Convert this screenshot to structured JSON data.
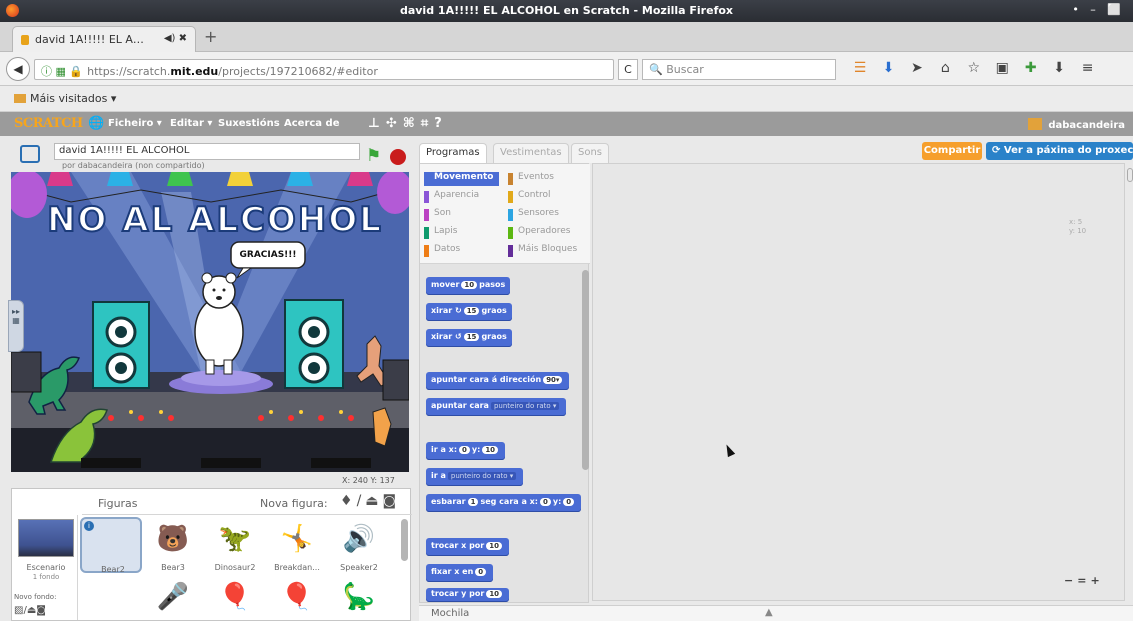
{
  "window": {
    "title": "david 1A!!!!! EL ALCOHOL en Scratch - Mozilla Firefox",
    "controls": "• – ⬜"
  },
  "browser": {
    "tab": {
      "label": "david 1A!!!!! EL A…",
      "controls": "◀) ✖"
    },
    "newtab": "+",
    "url_prefix": "https://scratch.",
    "url_domain": "mit.edu",
    "url_path": "/projects/197210682/#editor",
    "reload": "C",
    "search_placeholder": "Buscar",
    "bookmarks_label": "Máis visitados"
  },
  "scratch": {
    "logo": "SCRATCH",
    "menu": [
      "Ficheiro ▾",
      "Editar ▾",
      "Suxestións",
      "Acerca de"
    ],
    "user": "dabacandeira",
    "project_title": "david 1A!!!!! EL ALCOHOL",
    "project_owner": "por dabacandeira (non compartido)",
    "stage_coords": "X: 240  Y: 137",
    "stage": {
      "banner": "NO AL ALCOHOL",
      "speech": "GRACIAS!!!"
    },
    "tabs": {
      "scripts": "Programas",
      "costumes": "Vestimentas",
      "sounds": "Sons"
    },
    "share": "Compartir",
    "see_project": "Ver a páxina do proxecto",
    "categories": [
      {
        "label": "Movemento",
        "color": "#4a6cd4",
        "active": true
      },
      {
        "label": "Eventos",
        "color": "#c88330"
      },
      {
        "label": "Aparencia",
        "color": "#8a55d7"
      },
      {
        "label": "Control",
        "color": "#e1a91a"
      },
      {
        "label": "Son",
        "color": "#bb42c3"
      },
      {
        "label": "Sensores",
        "color": "#2ca5e2"
      },
      {
        "label": "Lapis",
        "color": "#0e9a6c"
      },
      {
        "label": "Operadores",
        "color": "#5cb712"
      },
      {
        "label": "Datos",
        "color": "#ee7d16"
      },
      {
        "label": "Máis Bloques",
        "color": "#632d99"
      }
    ],
    "blocks": {
      "move": {
        "a": "mover",
        "n": "10",
        "b": "pasos"
      },
      "turn_right": {
        "a": "xirar ↻",
        "n": "15",
        "b": "graos"
      },
      "turn_left": {
        "a": "xirar ↺",
        "n": "15",
        "b": "graos"
      },
      "point_dir": {
        "a": "apuntar cara á dirección",
        "n": "90▾"
      },
      "point_to": {
        "a": "apuntar cara",
        "d": "punteiro do rato ▾"
      },
      "goto_xy": {
        "a": "ir a x:",
        "n1": "0",
        "b": "y:",
        "n2": "10"
      },
      "goto": {
        "a": "ir a",
        "d": "punteiro do rato ▾"
      },
      "glide": {
        "a": "esbarar",
        "n1": "1",
        "b": "seg cara a x:",
        "n2": "0",
        "c": "y:",
        "n3": "0"
      },
      "change_x": {
        "a": "trocar x por",
        "n": "10"
      },
      "set_x": {
        "a": "fixar x en",
        "n": "0"
      },
      "change_y": {
        "a": "trocar y por",
        "n": "10"
      }
    },
    "sprites_title": "Figuras",
    "new_sprite": "Nova figura:",
    "stage_thumb": {
      "label": "Escenario",
      "sub": "1 fondo",
      "new_backdrop": "Novo fondo:"
    },
    "sprites": [
      "Bear2",
      "Bear3",
      "Dinosaur2",
      "Breakdan...",
      "Speaker2"
    ],
    "sprite_xy": {
      "x": "x: 5",
      "y": "y: 10"
    },
    "backpack": "Mochila",
    "zoom": [
      "−",
      "=",
      "+"
    ]
  }
}
